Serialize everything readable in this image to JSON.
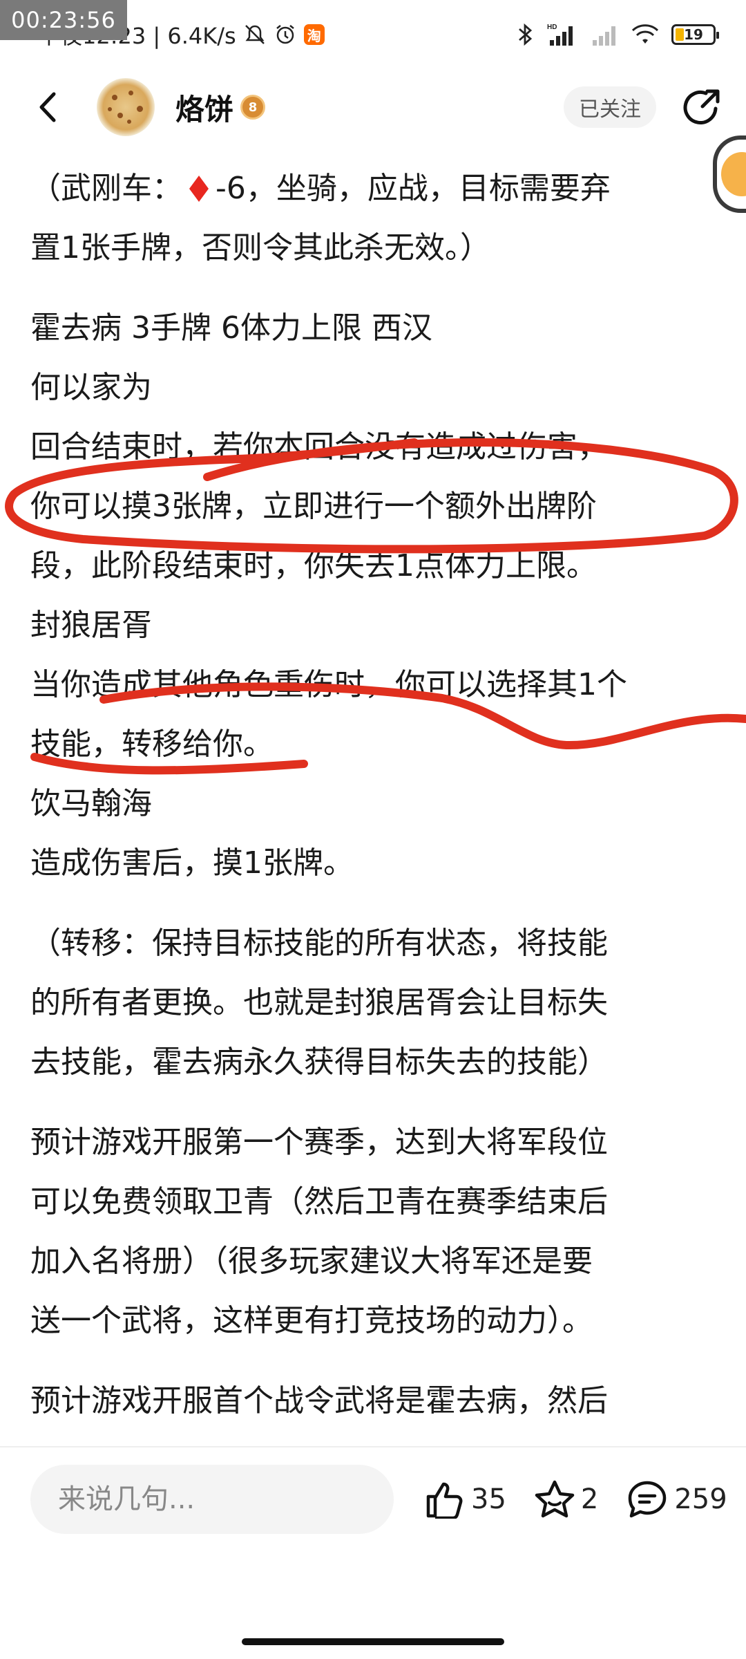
{
  "status_bar": {
    "recording_timer": "00:23:56",
    "time_and_speed": "半夜12:23 | 6.4K/s",
    "taobao_badge": "淘",
    "network_label": "HD",
    "battery_level": "19"
  },
  "header": {
    "username": "烙饼",
    "level": "8",
    "follow_label": "已关注"
  },
  "content": {
    "p1": [
      "（武刚车：",
      "-6，坐骑，应战，目标需要弃",
      "置1张手牌，否则令其此杀无效。）"
    ],
    "p2": [
      "霍去病 3手牌 6体力上限 西汉",
      "何以家为",
      "回合结束时，若你本回合没有造成过伤害，",
      "你可以摸3张牌，立即进行一个额外出牌阶",
      "段，此阶段结束时，你失去1点体力上限。",
      "封狼居胥",
      "当你造成其他角色重伤时，你可以选择其1个",
      "技能，转移给你。",
      "饮马翰海",
      "造成伤害后，摸1张牌。"
    ],
    "p3": [
      "（转移：保持目标技能的所有状态，将技能",
      "的所有者更换。也就是封狼居胥会让目标失",
      "去技能，霍去病永久获得目标失去的技能）"
    ],
    "p4": [
      "预计游戏开服第一个赛季，达到大将军段位",
      "可以免费领取卫青（然后卫青在赛季结束后",
      "加入名将册）（很多玩家建议大将军还是要",
      "送一个武将，这样更有打竞技场的动力）。"
    ],
    "p5": [
      "预计游戏开服首个战令武将是霍去病，然后"
    ]
  },
  "bottom_bar": {
    "comment_placeholder": "来说几句...",
    "like_count": "35",
    "favorite_count": "2",
    "comment_count": "259"
  },
  "colors": {
    "annotation_red": "#e0301e",
    "diamond_red": "#e8271f",
    "level_badge": "#d88c33"
  },
  "icons": [
    "back-arrow-icon",
    "share-icon",
    "like-icon",
    "star-icon",
    "comment-icon",
    "diamond-suit-icon",
    "bluetooth-icon",
    "signal-icon",
    "wifi-icon",
    "alarm-icon",
    "mute-icon",
    "battery-icon"
  ]
}
